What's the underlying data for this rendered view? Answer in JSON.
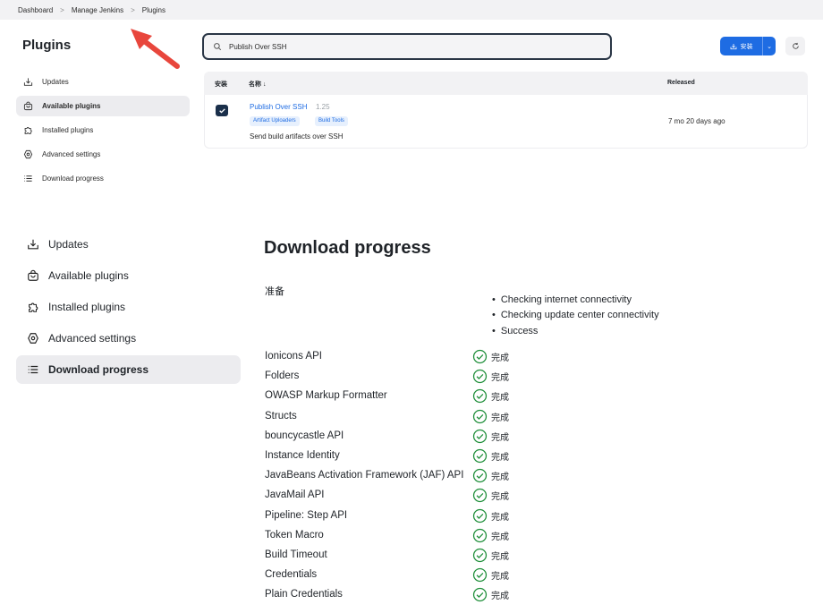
{
  "breadcrumb": [
    "Dashboard",
    "Manage Jenkins",
    "Plugins"
  ],
  "top": {
    "title": "Plugins",
    "sidebar": [
      {
        "label": "Updates",
        "icon": "download-icon",
        "active": false
      },
      {
        "label": "Available plugins",
        "icon": "shopping-bag-icon",
        "active": true
      },
      {
        "label": "Installed plugins",
        "icon": "puzzle-icon",
        "active": false
      },
      {
        "label": "Advanced settings",
        "icon": "gear-icon",
        "active": false
      },
      {
        "label": "Download progress",
        "icon": "list-icon",
        "active": false
      }
    ],
    "search": {
      "value": "Publish Over SSH"
    },
    "install_button": {
      "label": "安装"
    },
    "table": {
      "headers": {
        "install": "安装",
        "name": "名称 ↓",
        "released": "Released"
      },
      "rows": [
        {
          "checked": true,
          "name": "Publish Over SSH",
          "version": "1.25",
          "tags": [
            "Artifact Uploaders",
            "Build Tools"
          ],
          "description": "Send build artifacts over SSH",
          "released": "7 mo 20 days ago"
        }
      ]
    }
  },
  "bottom": {
    "sidebar": [
      {
        "label": "Updates",
        "icon": "download-icon",
        "active": false
      },
      {
        "label": "Available plugins",
        "icon": "shopping-bag-icon",
        "active": false
      },
      {
        "label": "Installed plugins",
        "icon": "puzzle-icon",
        "active": false
      },
      {
        "label": "Advanced settings",
        "icon": "gear-icon",
        "active": false
      },
      {
        "label": "Download progress",
        "icon": "list-icon",
        "active": true
      }
    ],
    "title": "Download progress",
    "preparation": {
      "label": "准备",
      "checks": [
        "Checking internet connectivity",
        "Checking update center connectivity",
        "Success"
      ]
    },
    "plugins": [
      {
        "name": "Ionicons API",
        "status": "完成"
      },
      {
        "name": "Folders",
        "status": "完成"
      },
      {
        "name": "OWASP Markup Formatter",
        "status": "完成"
      },
      {
        "name": "Structs",
        "status": "完成"
      },
      {
        "name": "bouncycastle API",
        "status": "完成"
      },
      {
        "name": "Instance Identity",
        "status": "完成"
      },
      {
        "name": "JavaBeans Activation Framework (JAF) API",
        "status": "完成"
      },
      {
        "name": "JavaMail API",
        "status": "完成"
      },
      {
        "name": "Pipeline: Step API",
        "status": "完成"
      },
      {
        "name": "Token Macro",
        "status": "完成"
      },
      {
        "name": "Build Timeout",
        "status": "完成"
      },
      {
        "name": "Credentials",
        "status": "完成"
      },
      {
        "name": "Plain Credentials",
        "status": "完成"
      }
    ]
  },
  "colors": {
    "accent": "#1e6ce3",
    "success": "#1f8f3a",
    "annotation_arrow": "#e8463c"
  }
}
